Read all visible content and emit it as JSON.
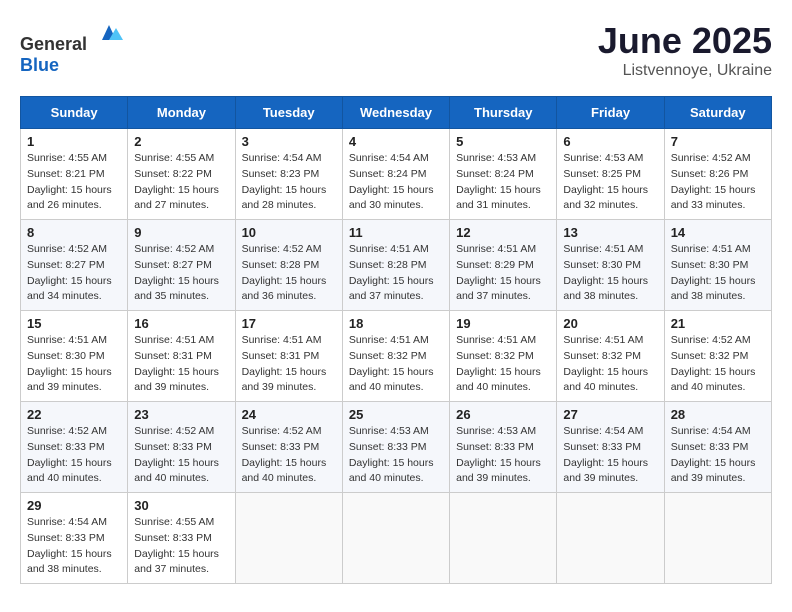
{
  "logo": {
    "general": "General",
    "blue": "Blue"
  },
  "title": "June 2025",
  "subtitle": "Listvennoye, Ukraine",
  "weekdays": [
    "Sunday",
    "Monday",
    "Tuesday",
    "Wednesday",
    "Thursday",
    "Friday",
    "Saturday"
  ],
  "weeks": [
    [
      {
        "day": "1",
        "sunrise": "Sunrise: 4:55 AM",
        "sunset": "Sunset: 8:21 PM",
        "daylight": "Daylight: 15 hours and 26 minutes."
      },
      {
        "day": "2",
        "sunrise": "Sunrise: 4:55 AM",
        "sunset": "Sunset: 8:22 PM",
        "daylight": "Daylight: 15 hours and 27 minutes."
      },
      {
        "day": "3",
        "sunrise": "Sunrise: 4:54 AM",
        "sunset": "Sunset: 8:23 PM",
        "daylight": "Daylight: 15 hours and 28 minutes."
      },
      {
        "day": "4",
        "sunrise": "Sunrise: 4:54 AM",
        "sunset": "Sunset: 8:24 PM",
        "daylight": "Daylight: 15 hours and 30 minutes."
      },
      {
        "day": "5",
        "sunrise": "Sunrise: 4:53 AM",
        "sunset": "Sunset: 8:24 PM",
        "daylight": "Daylight: 15 hours and 31 minutes."
      },
      {
        "day": "6",
        "sunrise": "Sunrise: 4:53 AM",
        "sunset": "Sunset: 8:25 PM",
        "daylight": "Daylight: 15 hours and 32 minutes."
      },
      {
        "day": "7",
        "sunrise": "Sunrise: 4:52 AM",
        "sunset": "Sunset: 8:26 PM",
        "daylight": "Daylight: 15 hours and 33 minutes."
      }
    ],
    [
      {
        "day": "8",
        "sunrise": "Sunrise: 4:52 AM",
        "sunset": "Sunset: 8:27 PM",
        "daylight": "Daylight: 15 hours and 34 minutes."
      },
      {
        "day": "9",
        "sunrise": "Sunrise: 4:52 AM",
        "sunset": "Sunset: 8:27 PM",
        "daylight": "Daylight: 15 hours and 35 minutes."
      },
      {
        "day": "10",
        "sunrise": "Sunrise: 4:52 AM",
        "sunset": "Sunset: 8:28 PM",
        "daylight": "Daylight: 15 hours and 36 minutes."
      },
      {
        "day": "11",
        "sunrise": "Sunrise: 4:51 AM",
        "sunset": "Sunset: 8:28 PM",
        "daylight": "Daylight: 15 hours and 37 minutes."
      },
      {
        "day": "12",
        "sunrise": "Sunrise: 4:51 AM",
        "sunset": "Sunset: 8:29 PM",
        "daylight": "Daylight: 15 hours and 37 minutes."
      },
      {
        "day": "13",
        "sunrise": "Sunrise: 4:51 AM",
        "sunset": "Sunset: 8:30 PM",
        "daylight": "Daylight: 15 hours and 38 minutes."
      },
      {
        "day": "14",
        "sunrise": "Sunrise: 4:51 AM",
        "sunset": "Sunset: 8:30 PM",
        "daylight": "Daylight: 15 hours and 38 minutes."
      }
    ],
    [
      {
        "day": "15",
        "sunrise": "Sunrise: 4:51 AM",
        "sunset": "Sunset: 8:30 PM",
        "daylight": "Daylight: 15 hours and 39 minutes."
      },
      {
        "day": "16",
        "sunrise": "Sunrise: 4:51 AM",
        "sunset": "Sunset: 8:31 PM",
        "daylight": "Daylight: 15 hours and 39 minutes."
      },
      {
        "day": "17",
        "sunrise": "Sunrise: 4:51 AM",
        "sunset": "Sunset: 8:31 PM",
        "daylight": "Daylight: 15 hours and 39 minutes."
      },
      {
        "day": "18",
        "sunrise": "Sunrise: 4:51 AM",
        "sunset": "Sunset: 8:32 PM",
        "daylight": "Daylight: 15 hours and 40 minutes."
      },
      {
        "day": "19",
        "sunrise": "Sunrise: 4:51 AM",
        "sunset": "Sunset: 8:32 PM",
        "daylight": "Daylight: 15 hours and 40 minutes."
      },
      {
        "day": "20",
        "sunrise": "Sunrise: 4:51 AM",
        "sunset": "Sunset: 8:32 PM",
        "daylight": "Daylight: 15 hours and 40 minutes."
      },
      {
        "day": "21",
        "sunrise": "Sunrise: 4:52 AM",
        "sunset": "Sunset: 8:32 PM",
        "daylight": "Daylight: 15 hours and 40 minutes."
      }
    ],
    [
      {
        "day": "22",
        "sunrise": "Sunrise: 4:52 AM",
        "sunset": "Sunset: 8:33 PM",
        "daylight": "Daylight: 15 hours and 40 minutes."
      },
      {
        "day": "23",
        "sunrise": "Sunrise: 4:52 AM",
        "sunset": "Sunset: 8:33 PM",
        "daylight": "Daylight: 15 hours and 40 minutes."
      },
      {
        "day": "24",
        "sunrise": "Sunrise: 4:52 AM",
        "sunset": "Sunset: 8:33 PM",
        "daylight": "Daylight: 15 hours and 40 minutes."
      },
      {
        "day": "25",
        "sunrise": "Sunrise: 4:53 AM",
        "sunset": "Sunset: 8:33 PM",
        "daylight": "Daylight: 15 hours and 40 minutes."
      },
      {
        "day": "26",
        "sunrise": "Sunrise: 4:53 AM",
        "sunset": "Sunset: 8:33 PM",
        "daylight": "Daylight: 15 hours and 39 minutes."
      },
      {
        "day": "27",
        "sunrise": "Sunrise: 4:54 AM",
        "sunset": "Sunset: 8:33 PM",
        "daylight": "Daylight: 15 hours and 39 minutes."
      },
      {
        "day": "28",
        "sunrise": "Sunrise: 4:54 AM",
        "sunset": "Sunset: 8:33 PM",
        "daylight": "Daylight: 15 hours and 39 minutes."
      }
    ],
    [
      {
        "day": "29",
        "sunrise": "Sunrise: 4:54 AM",
        "sunset": "Sunset: 8:33 PM",
        "daylight": "Daylight: 15 hours and 38 minutes."
      },
      {
        "day": "30",
        "sunrise": "Sunrise: 4:55 AM",
        "sunset": "Sunset: 8:33 PM",
        "daylight": "Daylight: 15 hours and 37 minutes."
      },
      null,
      null,
      null,
      null,
      null
    ]
  ]
}
